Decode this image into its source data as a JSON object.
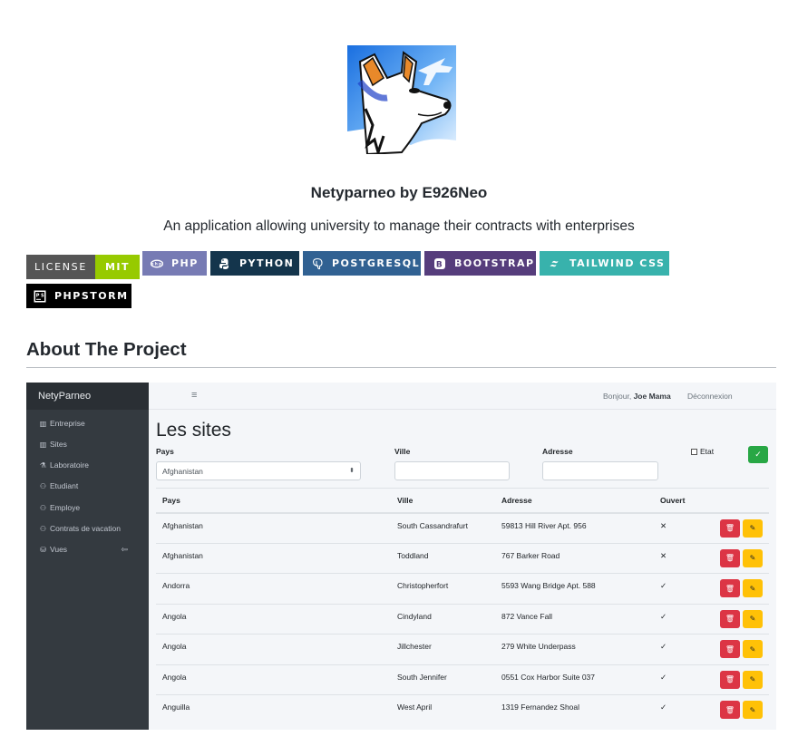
{
  "readme": {
    "title": "Netyparneo by E926Neo",
    "subtitle": "An application allowing university to manage their contracts with enterprises",
    "about_heading": "About The Project"
  },
  "badges": {
    "license_left": "LICENSE",
    "license_right": "MIT",
    "php": "PHP",
    "python": "PYTHON",
    "postgresql": "POSTGRESQL",
    "bootstrap": "BOOTSTRAP",
    "tailwind": "TAILWIND CSS",
    "phpstorm": "PHPSTORM"
  },
  "colors": {
    "license_left": "#555555",
    "license_right": "#97ca00",
    "php": "#777bb4",
    "python": "#14354c",
    "postgresql": "#316192",
    "bootstrap": "#563d7c",
    "tailwind": "#38b2ac",
    "phpstorm": "#000000",
    "sidebar": "#343a40",
    "danger": "#dc3545",
    "warning": "#ffc107",
    "success": "#28a745"
  },
  "app": {
    "brand": "NetyParneo",
    "menu_icon": "hamburger-icon",
    "greeting_prefix": "Bonjour,",
    "user_name": "Joe Mama",
    "logout": "Déconnexion",
    "sidebar": [
      {
        "label": "Entreprise",
        "icon": "building-icon"
      },
      {
        "label": "Sites",
        "icon": "building-icon"
      },
      {
        "label": "Laboratoire",
        "icon": "flask-icon"
      },
      {
        "label": "Etudiant",
        "icon": "users-icon"
      },
      {
        "label": "Employe",
        "icon": "users-icon"
      },
      {
        "label": "Contrats de vacation",
        "icon": "users-icon"
      },
      {
        "label": "Vues",
        "icon": "database-icon"
      }
    ],
    "page_title": "Les sites",
    "filters": {
      "pays_label": "Pays",
      "pays_value": "Afghanistan",
      "ville_label": "Ville",
      "ville_value": "",
      "adresse_label": "Adresse",
      "adresse_value": "",
      "etat_label": "Etat",
      "etat_checked": false
    },
    "table": {
      "headers": [
        "Pays",
        "Ville",
        "Adresse",
        "Ouvert"
      ],
      "rows": [
        {
          "pays": "Afghanistan",
          "ville": "South Cassandrafurt",
          "adresse": "59813 Hill River Apt. 956",
          "ouvert": "✕"
        },
        {
          "pays": "Afghanistan",
          "ville": "Toddland",
          "adresse": "767 Barker Road",
          "ouvert": "✕"
        },
        {
          "pays": "Andorra",
          "ville": "Christopherfort",
          "adresse": "5593 Wang Bridge Apt. 588",
          "ouvert": "✓"
        },
        {
          "pays": "Angola",
          "ville": "Cindyland",
          "adresse": "872 Vance Fall",
          "ouvert": "✓"
        },
        {
          "pays": "Angola",
          "ville": "Jillchester",
          "adresse": "279 White Underpass",
          "ouvert": "✓"
        },
        {
          "pays": "Angola",
          "ville": "South Jennifer",
          "adresse": "0551 Cox Harbor Suite 037",
          "ouvert": "✓"
        },
        {
          "pays": "Anguilla",
          "ville": "West April",
          "adresse": "1319 Fernandez Shoal",
          "ouvert": "✓"
        }
      ]
    }
  }
}
